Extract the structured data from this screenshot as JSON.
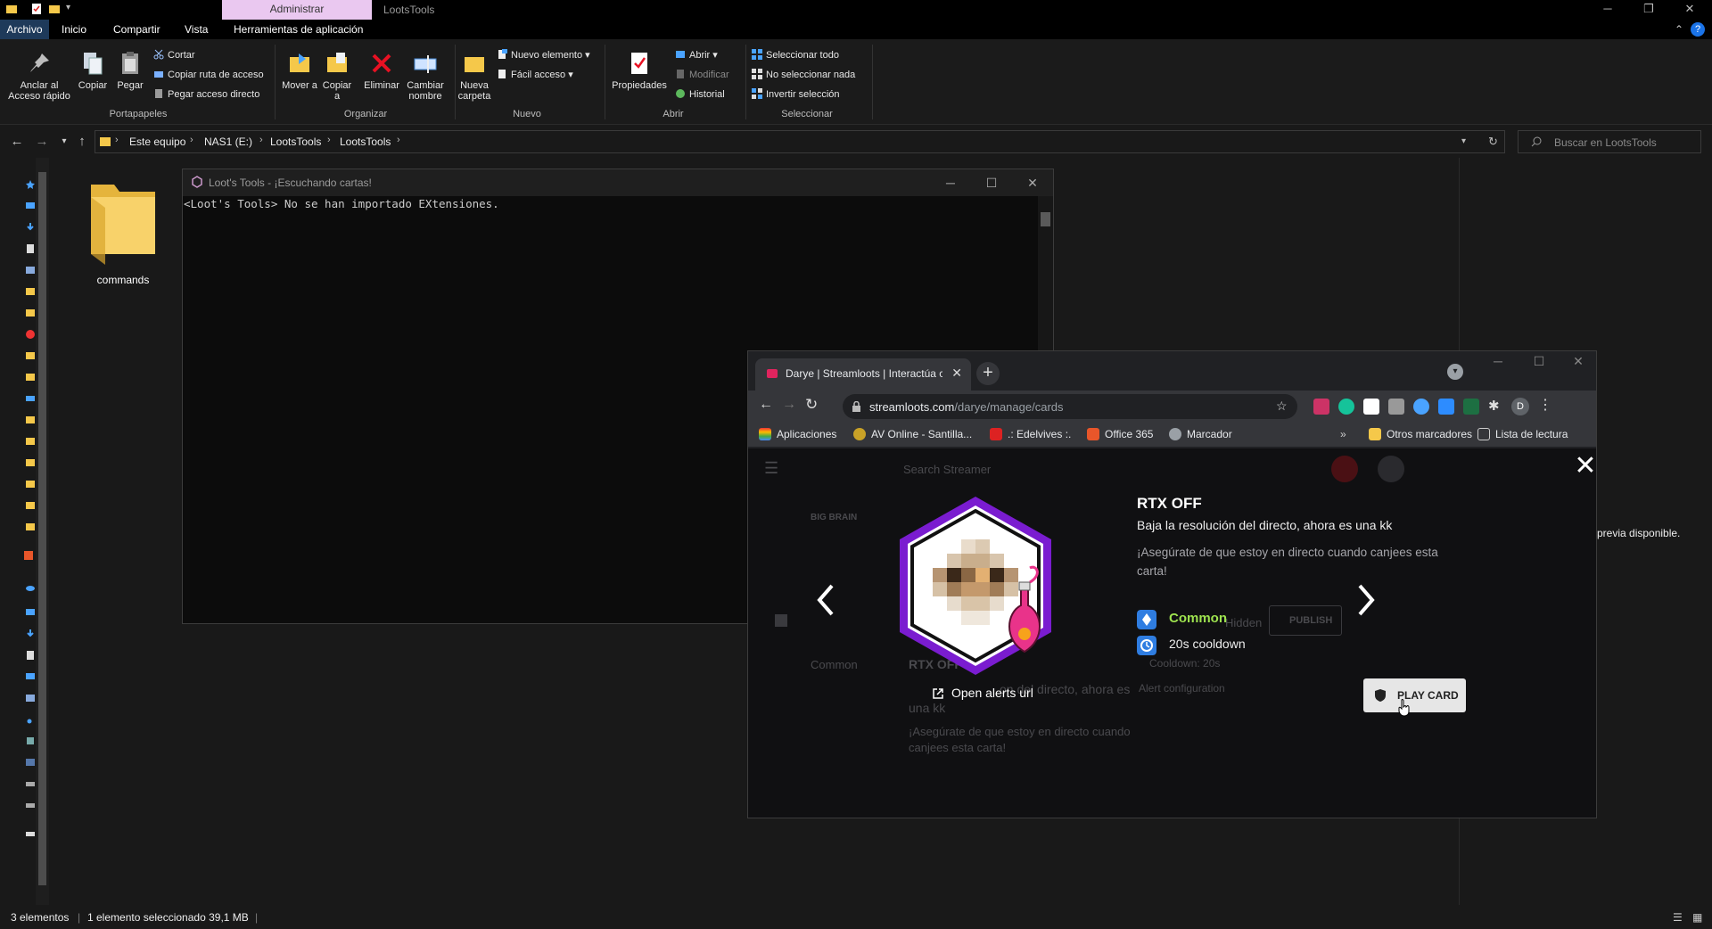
{
  "explorer": {
    "contextual_tab": "Administrar",
    "window_title": "LootsTools",
    "ribbon_tabs": [
      "Archivo",
      "Inicio",
      "Compartir",
      "Vista",
      "Herramientas de aplicación"
    ],
    "clipboard": {
      "pin_label": "Anclar al Acceso rápido",
      "copy_label": "Copiar",
      "paste_label": "Pegar",
      "cut_label": "Cortar",
      "copy_path_label": "Copiar ruta de acceso",
      "paste_shortcut_label": "Pegar acceso directo",
      "group_label": "Portapapeles"
    },
    "organize": {
      "move_label": "Mover a",
      "copy_to_label": "Copiar a",
      "delete_label": "Eliminar",
      "rename_label": "Cambiar nombre",
      "group_label": "Organizar"
    },
    "new": {
      "new_folder_label": "Nueva carpeta",
      "new_item_label": "Nuevo elemento",
      "easy_access_label": "Fácil acceso",
      "group_label": "Nuevo"
    },
    "open": {
      "properties_label": "Propiedades",
      "open_label": "Abrir",
      "edit_label": "Modificar",
      "history_label": "Historial",
      "group_label": "Abrir"
    },
    "select": {
      "select_all_label": "Seleccionar todo",
      "select_none_label": "No seleccionar nada",
      "invert_label": "Invertir selección",
      "group_label": "Seleccionar"
    },
    "breadcrumb": [
      "Este equipo",
      "NAS1 (E:)",
      "LootsTools",
      "LootsTools"
    ],
    "search_placeholder": "Buscar en LootsTools",
    "folder_name": "commands",
    "preview_text": "previa disponible.",
    "status": {
      "count": "3 elementos",
      "selection": "1 elemento seleccionado  39,1 MB"
    }
  },
  "console": {
    "title": "Loot's Tools - ¡Escuchando cartas!",
    "output": "<Loot's Tools> No se han importado EXtensiones."
  },
  "browser": {
    "tab_title": "Darye | Streamloots | Interactúa con",
    "url_host": "streamloots.com",
    "url_path": "/darye/manage/cards",
    "profile_initial": "D",
    "bookmarks": [
      "Aplicaciones",
      "AV Online - Santilla...",
      ".: Edelvives :.",
      "Office 365",
      "Marcador"
    ],
    "other_bookmarks": "Otros marcadores",
    "reading_list": "Lista de lectura",
    "page_bg": {
      "search": "Search Streamer",
      "big_brain": "BIG BRAIN",
      "hidden": "Hidden",
      "publish": "PUBLISH",
      "common": "Common",
      "card_name": "RTX OFF",
      "cooldown": "Cooldown: 20s",
      "alert_config": "Alert configuration",
      "desc_fragment": "on del directo, ahora es",
      "desc_fragment2": "una kk",
      "note_fragment": "¡Asegúrate de que estoy en directo cuando",
      "note_fragment2": "canjees esta carta!"
    },
    "card": {
      "title": "RTX OFF",
      "description": "Baja la resolución del directo, ahora es una kk",
      "note": "¡Asegúrate de que estoy en directo cuando canjees esta carta!",
      "rarity": "Common",
      "cooldown": "20s cooldown",
      "open_alerts": "Open alerts url",
      "play_button": "PLAY CARD"
    }
  },
  "colors": {
    "accent_rarity": "#9ee34f",
    "card_border": "#8a1fd9",
    "rarity_icon": "#2f7de1"
  }
}
